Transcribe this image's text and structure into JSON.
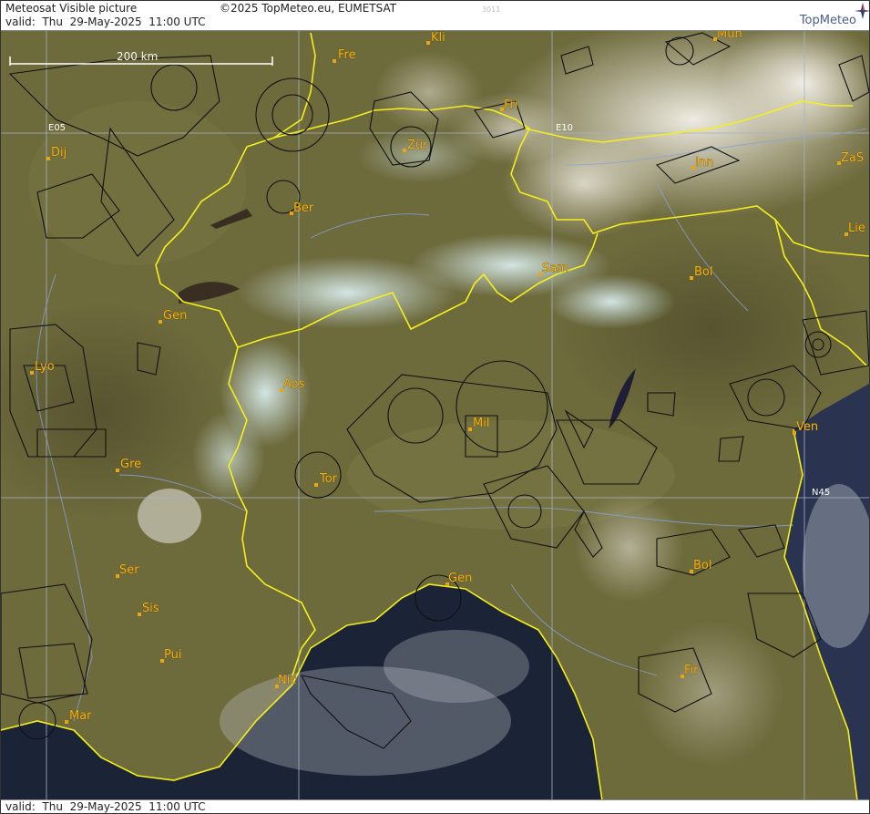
{
  "header": {
    "product": "Meteosat Visible picture",
    "copyright": "©2025 TopMeteo.eu, EUMETSAT",
    "code": "3011",
    "valid": "valid:  Thu  29-May-2025  11:00 UTC",
    "logo_text": "TopMeteo"
  },
  "footer": {
    "valid": "valid:  Thu  29-May-2025  11:00 UTC"
  },
  "scale_bar": {
    "label": "200 km"
  },
  "grid_labels": {
    "e05": "E05",
    "e10": "E10",
    "n45": "N45"
  },
  "cities": {
    "kli": "Kli",
    "mun": "Mun",
    "fre": "Fre",
    "fri": "Fri",
    "zur": "Zür",
    "inn": "Inn",
    "zas": "ZaS",
    "dij": "Dij",
    "ber": "Ber",
    "lie": "Lie",
    "sam": "Sam",
    "bol_n": "Bol",
    "gen_ch": "Gen",
    "lyo": "Lyo",
    "aos": "Aos",
    "mil": "Mil",
    "ven": "Ven",
    "gre": "Gre",
    "tor": "Tor",
    "ser": "Ser",
    "gen_it": "Gen",
    "bol_s": "Bol",
    "sis": "Sis",
    "pui": "Pui",
    "nic": "Nic",
    "fir": "Fir",
    "mar": "Mar"
  },
  "colors": {
    "land": "#6b6a3a",
    "sea": "#1a2236",
    "border": "#f4ef1c",
    "city_label": "#f3b31c",
    "airspace": "#111111",
    "river": "#8aa1d8"
  }
}
